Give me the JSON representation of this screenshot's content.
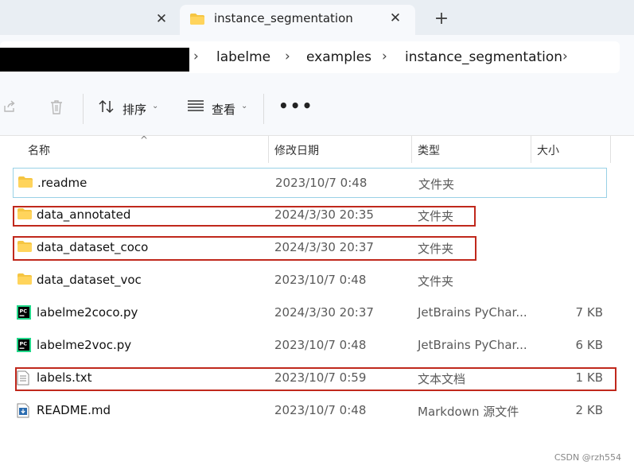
{
  "tabs": {
    "previous_close": "✕",
    "active_title": "instance_segmentation",
    "active_close": "✕",
    "new_tab": "+"
  },
  "address": {
    "crumbs": [
      "labelme",
      "examples",
      "instance_segmentation"
    ],
    "separator": "›"
  },
  "toolbar": {
    "sort_label": "排序",
    "view_label": "查看",
    "more_label": "•••",
    "chevron": "⌄"
  },
  "columns": {
    "name": "名称",
    "modified": "修改日期",
    "type": "类型",
    "size": "大小"
  },
  "files": [
    {
      "name": ".readme",
      "date": "2023/10/7 0:48",
      "type": "文件夹",
      "size": "",
      "icon": "folder-icon"
    },
    {
      "name": "data_annotated",
      "date": "2024/3/30 20:35",
      "type": "文件夹",
      "size": "",
      "icon": "folder-icon"
    },
    {
      "name": "data_dataset_coco",
      "date": "2024/3/30 20:37",
      "type": "文件夹",
      "size": "",
      "icon": "folder-icon"
    },
    {
      "name": "data_dataset_voc",
      "date": "2023/10/7 0:48",
      "type": "文件夹",
      "size": "",
      "icon": "folder-icon"
    },
    {
      "name": "labelme2coco.py",
      "date": "2024/3/30 20:37",
      "type": "JetBrains PyChar...",
      "size": "7 KB",
      "icon": "pycharm-file-icon"
    },
    {
      "name": "labelme2voc.py",
      "date": "2023/10/7 0:48",
      "type": "JetBrains PyChar...",
      "size": "6 KB",
      "icon": "pycharm-file-icon"
    },
    {
      "name": "labels.txt",
      "date": "2023/10/7 0:59",
      "type": "文本文档",
      "size": "1 KB",
      "icon": "text-file-icon"
    },
    {
      "name": "README.md",
      "date": "2023/10/7 0:48",
      "type": "Markdown 源文件",
      "size": "2 KB",
      "icon": "markdown-file-icon"
    }
  ],
  "watermark": "CSDN @rzh554",
  "colors": {
    "highlight_box": "#c0281c",
    "selection_border": "#99d1e6",
    "folder": "#f5c542"
  }
}
